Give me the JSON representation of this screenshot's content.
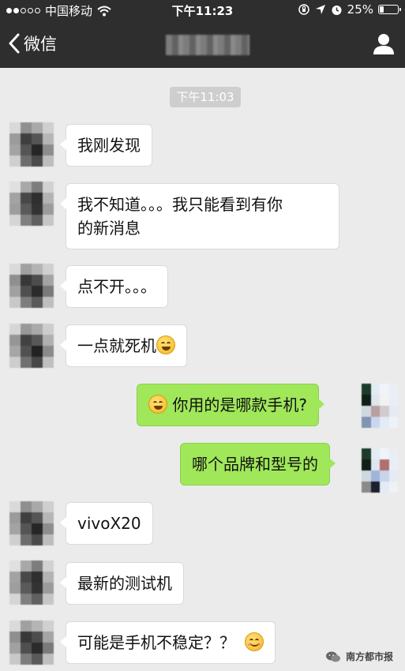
{
  "status_bar": {
    "carrier": "中国移动",
    "time": "下午11:23",
    "battery": "25%",
    "signal_dots_filled": 2,
    "signal_dots_total": 5
  },
  "nav": {
    "back_label": "微信",
    "title": ""
  },
  "timestamp": "下午11:03",
  "messages": [
    {
      "side": "in",
      "parts": [
        "我刚发现"
      ]
    },
    {
      "side": "in",
      "parts": [
        "我不知道。。。我只能看到有你",
        "的新消息"
      ]
    },
    {
      "side": "in",
      "parts": [
        "点不开。。。"
      ]
    },
    {
      "side": "in",
      "parts": [
        "一点就死机"
      ],
      "emoji": "tears-of-joy-emoji"
    },
    {
      "side": "out",
      "parts": [
        "你用的是哪款手机?"
      ],
      "emoji": "tears-of-joy-emoji"
    },
    {
      "side": "out",
      "parts": [
        "哪个品牌和型号的"
      ]
    },
    {
      "side": "in",
      "parts": [
        "vivoX20"
      ]
    },
    {
      "side": "in",
      "parts": [
        "最新的测试机"
      ]
    },
    {
      "side": "in",
      "parts": [
        "可能是手机不稳定？？"
      ],
      "emoji": "smiling-blush-emoji"
    }
  ],
  "watermark": "南方都市报",
  "colors": {
    "header_bg": "#2e2e2e",
    "chat_bg": "#ebebeb",
    "outgoing_bubble": "#a0e75a",
    "incoming_bubble": "#ffffff",
    "time_badge": "#cecece"
  }
}
